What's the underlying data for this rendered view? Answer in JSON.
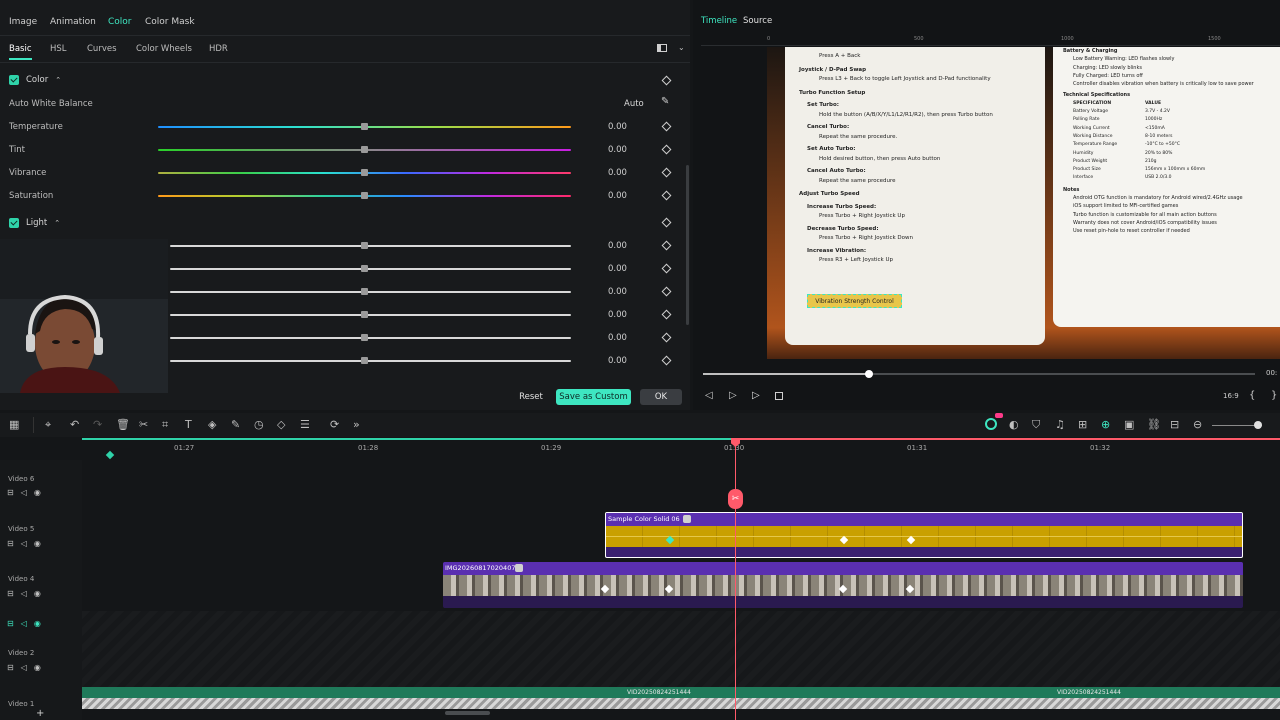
{
  "top_tabs": [
    "Image",
    "Animation",
    "Color",
    "Color Mask"
  ],
  "sub_tabs": [
    "Basic",
    "HSL",
    "Curves",
    "Color Wheels",
    "HDR"
  ],
  "color_section": {
    "label": "Color",
    "auto_white_balance_label": "Auto White Balance",
    "auto_button": "Auto",
    "rows": [
      {
        "label": "Temperature",
        "value": "0.00"
      },
      {
        "label": "Tint",
        "value": "0.00"
      },
      {
        "label": "Vibrance",
        "value": "0.00"
      },
      {
        "label": "Saturation",
        "value": "0.00"
      }
    ]
  },
  "light_section": {
    "label": "Light",
    "values": [
      "0.00",
      "0.00",
      "0.00",
      "0.00",
      "0.00",
      "0.00"
    ]
  },
  "buttons": {
    "reset": "Reset",
    "save_custom": "Save as Custom",
    "ok": "OK"
  },
  "preview": {
    "tabs": [
      "Timeline",
      "Source"
    ],
    "ruler_marks": [
      "0",
      "500",
      "1000",
      "1500"
    ],
    "timecode": "00:",
    "overlay_text": "Vibration Strength Control",
    "doc_left": [
      "Press A + Back",
      "Joystick / D-Pad Swap",
      "Press L3 + Back to toggle Left Joystick and D-Pad functionality",
      "Turbo Function Setup",
      "Set Turbo:",
      "Hold the button (A/B/X/Y/L1/L2/R1/R2), then press Turbo button",
      "Cancel Turbo:",
      "Repeat the same procedure.",
      "Set Auto Turbo:",
      "Hold desired button, then press Auto button",
      "Cancel Auto Turbo:",
      "Repeat the same procedure",
      "Adjust Turbo Speed",
      "Increase Turbo Speed:",
      "Press Turbo + Right Joystick Up",
      "Decrease Turbo Speed:",
      "Press Turbo + Right Joystick Down",
      "Increase Vibration:",
      "Press R3 + Left Joystick Up"
    ],
    "doc_right": [
      "Battery & Charging",
      "Low Battery Warning: LED flashes slowly",
      "Charging: LED slowly blinks",
      "Fully Charged: LED turns off",
      "Controller disables vibration when battery is critically low to save power",
      "Technical Specifications",
      "Notes",
      "Android OTG function is mandatory for Android wired/2.4GHz usage",
      "iOS support limited to MFi-certified games",
      "Turbo function is customizable for all main action buttons",
      "Warranty does not cover Android/iOS compatibility issues",
      "Use reset pin-hole to reset controller if needed"
    ],
    "spec_header": [
      "SPECIFICATION",
      "VALUE"
    ],
    "spec_rows": [
      [
        "Battery Voltage",
        "3.7V - 4.2V"
      ],
      [
        "Polling Rate",
        "1000Hz"
      ],
      [
        "Working Current",
        "<150mA"
      ],
      [
        "Working Distance",
        "8-10 meters"
      ],
      [
        "Temperature Range",
        "-10°C to +50°C"
      ],
      [
        "Humidity",
        "20% to 80%"
      ],
      [
        "Product Weight",
        "210g"
      ],
      [
        "Product Size",
        "156mm x 100mm x 60mm"
      ],
      [
        "Interface",
        "USB 2.0/3.0"
      ]
    ],
    "progress": 0.3,
    "ratio_label": "16:9"
  },
  "timeline": {
    "ruler_labels": [
      "01:27",
      "01:28",
      "01:29",
      "01:30",
      "01:31",
      "01:32"
    ],
    "tracks": [
      {
        "name": "Video 6"
      },
      {
        "name": "Video 5"
      },
      {
        "name": "Video 4"
      },
      {
        "name": "Video 3"
      },
      {
        "name": "Video 2"
      },
      {
        "name": "Video 1"
      }
    ],
    "clip_color": "Sample Color Solid 06",
    "clip_video": "IMG20260817020407",
    "clip_bottom_1": "VID20250824251444",
    "clip_bottom_2": "VID20250824251444"
  },
  "colors": {
    "accent": "#3ee6c1",
    "playhead": "#ff5a6a",
    "clip_purple": "#5a2fb0",
    "clip_yellow": "#c9a000"
  }
}
